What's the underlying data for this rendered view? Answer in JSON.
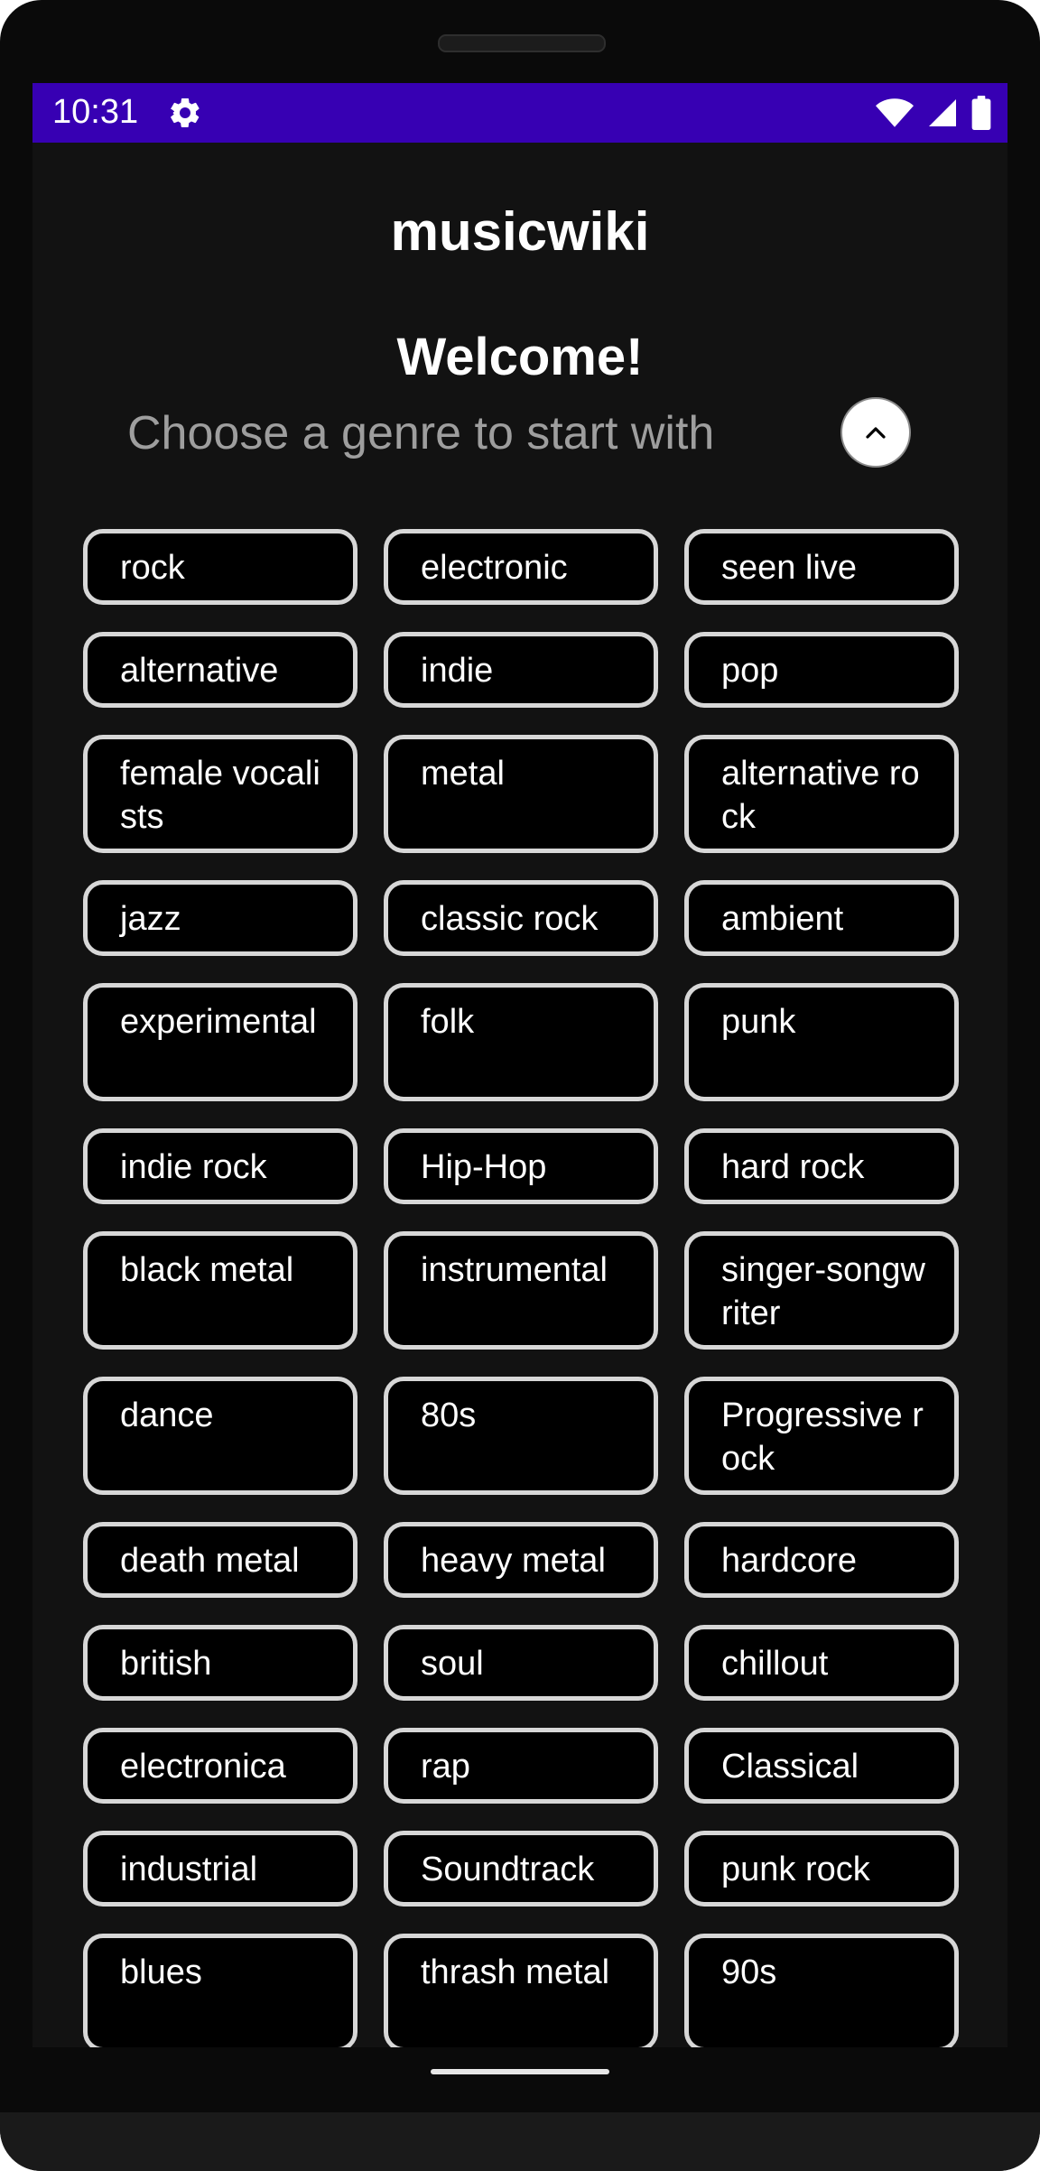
{
  "status_bar": {
    "time": "10:31",
    "icons": [
      "settings-gear-icon",
      "wifi-icon",
      "signal-icon",
      "battery-icon"
    ],
    "color": "#3700b3"
  },
  "app": {
    "title": "musicwiki",
    "welcome": "Welcome!",
    "subtitle": "Choose a genre to start with",
    "collapse_icon": "chevron-up-icon"
  },
  "genres": [
    "rock",
    "electronic",
    "seen live",
    "alternative",
    "indie",
    "pop",
    "female vocalists",
    "metal",
    "alternative rock",
    "jazz",
    "classic rock",
    "ambient",
    "experimental",
    "folk",
    "punk",
    "indie rock",
    "Hip-Hop",
    "hard rock",
    "black metal",
    "instrumental",
    "singer-songwriter",
    "dance",
    "80s",
    "Progressive rock",
    "death metal",
    "heavy metal",
    "hardcore",
    "british",
    "soul",
    "chillout",
    "electronica",
    "rap",
    "Classical",
    "industrial",
    "Soundtrack",
    "punk rock",
    "blues",
    "thrash metal",
    "90s"
  ],
  "colors": {
    "background": "#121212",
    "chip_background": "#000000",
    "chip_border": "#d7d7d7",
    "subtitle": "#9e9e9e"
  }
}
